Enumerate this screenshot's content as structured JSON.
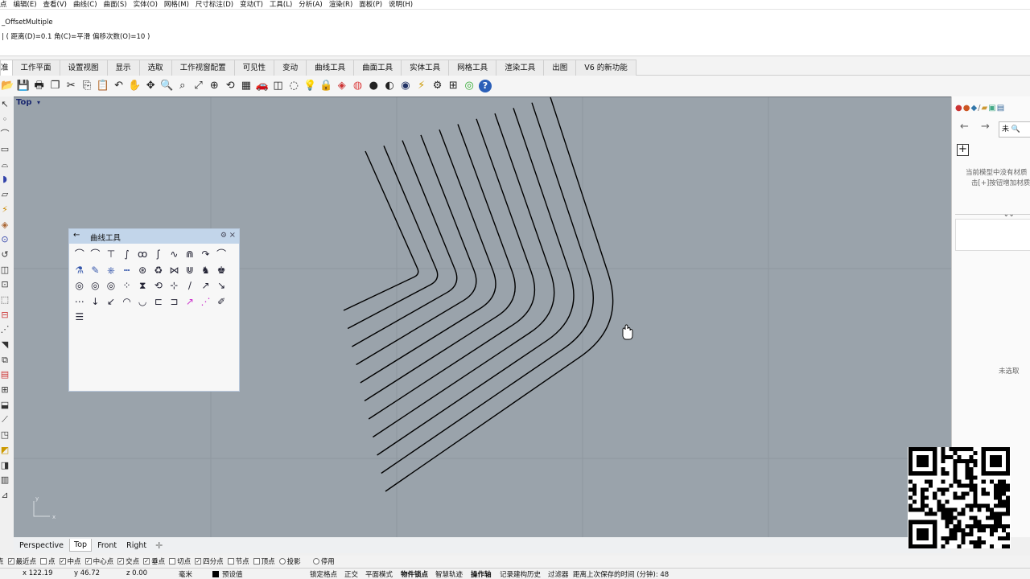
{
  "menu": {
    "items": [
      "点",
      "编辑(E)",
      "查看(V)",
      "曲线(C)",
      "曲面(S)",
      "实体(O)",
      "网格(M)",
      "尺寸标注(D)",
      "变动(T)",
      "工具(L)",
      "分析(A)",
      "渲染(R)",
      "面板(P)",
      "说明(H)"
    ]
  },
  "command": {
    "line1": "_OffsetMultiple",
    "line2": "| ( 距离(D)=0.1  角(C)=平滑  偏移次数(O)=10 )"
  },
  "tabs": [
    "准",
    "工作平面",
    "设置视图",
    "显示",
    "选取",
    "工作视窗配置",
    "可见性",
    "变动",
    "曲线工具",
    "曲面工具",
    "实体工具",
    "网格工具",
    "渲染工具",
    "出图",
    "V6 的新功能"
  ],
  "toolbar_icons": [
    "open-icon",
    "save-icon",
    "print-icon",
    "import-icon",
    "cut-icon",
    "copy-icon",
    "paste-icon",
    "undo-icon",
    "pan-icon",
    "move-icon",
    "zoom-icon",
    "zoom-window-icon",
    "zoom-extents-icon",
    "zoom-selected-icon",
    "rotate-view-icon",
    "grid-icon",
    "car-icon",
    "cplane-icon",
    "sphere-icon",
    "light-icon",
    "lock-icon",
    "paint-bucket-icon",
    "color-wheel-icon",
    "render-sphere-icon",
    "shade-icon",
    "material-sphere-icon",
    "bolt-icon",
    "gear-icon",
    "network-icon",
    "earth-icon",
    "help-icon"
  ],
  "viewport": {
    "title": "Top",
    "axis_y": "y",
    "axis_x": "x"
  },
  "panel": {
    "title": "曲线工具",
    "back_glyph": "←",
    "gear_glyph": "⚙",
    "close_glyph": "×"
  },
  "rightpanel": {
    "search_value": "未",
    "message_line1": "当前模型中没有材质",
    "message_line2": "击[+]按钮增加材质",
    "none_selected": "未选取",
    "plus_label": "+"
  },
  "view_tabs": [
    "Perspective",
    "Top",
    "Front",
    "Right"
  ],
  "active_view_tab": "Top",
  "osnaps": [
    {
      "label": "点",
      "checked": false,
      "partial": true
    },
    {
      "label": "最近点",
      "checked": true
    },
    {
      "label": "点",
      "checked": false
    },
    {
      "label": "中点",
      "checked": true
    },
    {
      "label": "中心点",
      "checked": true
    },
    {
      "label": "交点",
      "checked": true
    },
    {
      "label": "垂点",
      "checked": true
    },
    {
      "label": "切点",
      "checked": false
    },
    {
      "label": "四分点",
      "checked": true
    },
    {
      "label": "节点",
      "checked": false
    },
    {
      "label": "顶点",
      "checked": false
    },
    {
      "label": "投影",
      "checked": false,
      "radio": true
    },
    {
      "label": "停用",
      "checked": false,
      "radio": true
    }
  ],
  "status": {
    "x": "x 122.19",
    "y": "y 46.72",
    "z": "z 0.00",
    "unit": "毫米",
    "layer": "预设值",
    "grid_snap": "锁定格点",
    "ortho": "正交",
    "planar": "平面模式",
    "osnap": "物件锁点",
    "smarttrack": "智慧轨迹",
    "gumball": "操作轴",
    "history": "记录建构历史",
    "filter": "过滤器",
    "autosave": "距离上次保存的时间 (分钟): 48"
  },
  "colors": {
    "viewport_bg": "#9aa3ab",
    "curve": "#000000",
    "panel_header": "#c2d5ea",
    "viewport_title": "#1c2a70"
  }
}
